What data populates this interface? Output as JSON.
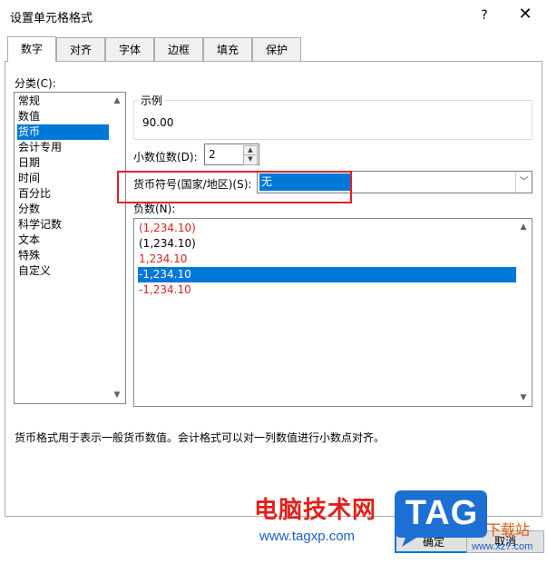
{
  "window": {
    "title": "设置单元格格式",
    "help": "?",
    "close": "✕"
  },
  "tabs": [
    "数字",
    "对齐",
    "字体",
    "边框",
    "填充",
    "保护"
  ],
  "category": {
    "label": "分类(C):",
    "items": [
      "常规",
      "数值",
      "货币",
      "会计专用",
      "日期",
      "时间",
      "百分比",
      "分数",
      "科学记数",
      "文本",
      "特殊",
      "自定义"
    ],
    "selected": "货币"
  },
  "sample": {
    "legend": "示例",
    "value": "90.00"
  },
  "decimal": {
    "label": "小数位数(D):",
    "value": "2"
  },
  "currency": {
    "label": "货币符号(国家/地区)(S):",
    "value": "无"
  },
  "negative": {
    "label": "负数(N):",
    "items": [
      {
        "text": "(1,234.10)",
        "color": "#e0211b"
      },
      {
        "text": "(1,234.10)",
        "color": "#000000"
      },
      {
        "text": "1,234.10",
        "color": "#e0211b"
      },
      {
        "text": "-1,234.10",
        "color": "#ffffff"
      },
      {
        "text": "-1,234.10",
        "color": "#e0211b"
      }
    ]
  },
  "description": "货币格式用于表示一般货币数值。会计格式可以对一列数值进行小数点对齐。",
  "buttons": {
    "ok": "确定",
    "cancel": "取消"
  },
  "watermark": {
    "text": "电脑技术网",
    "url": "www.tagxp.com",
    "logo": "TAG",
    "sub": "下载站",
    "site": "www.xz7.com"
  },
  "colors": {
    "accent": "#0078d7",
    "highlight": "#e0211b"
  }
}
